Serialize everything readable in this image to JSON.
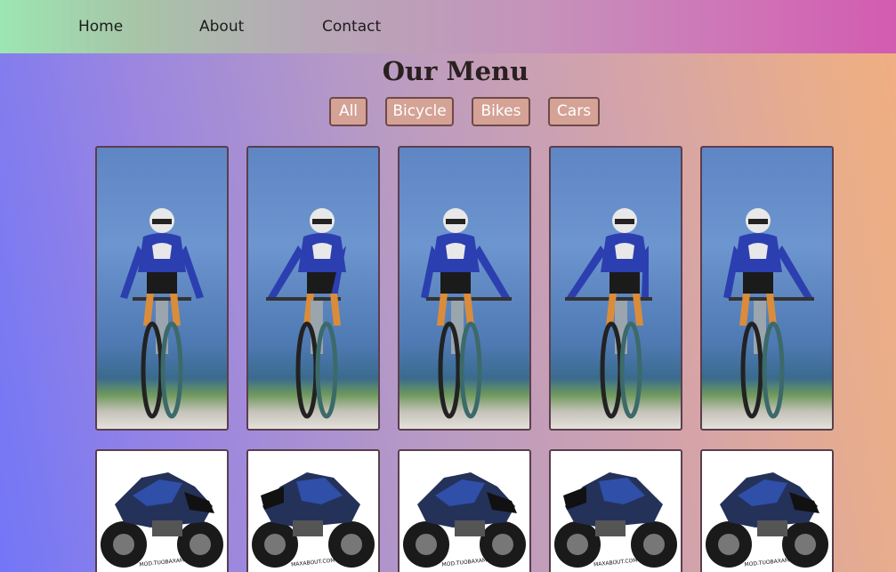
{
  "nav": {
    "home": "Home",
    "about": "About",
    "contact": "Contact"
  },
  "menu": {
    "title": "Our Menu",
    "filters": [
      "All",
      "Bicycle",
      "Bikes",
      "Cars"
    ]
  },
  "gallery": {
    "rows": [
      {
        "category": "Bicycle",
        "items": 5
      },
      {
        "category": "Bikes",
        "items": 5,
        "watermarks": [
          "MOD.TUOBAXAM",
          "MAXABOUT.COM",
          "MOD.TUOBAXAM",
          "MAXABOUT.COM",
          "MOD.TUOBAXAM"
        ]
      }
    ]
  },
  "colors": {
    "filter_button": "#d5a296",
    "filter_border": "#6e4a4a",
    "title": "#2a2020"
  }
}
